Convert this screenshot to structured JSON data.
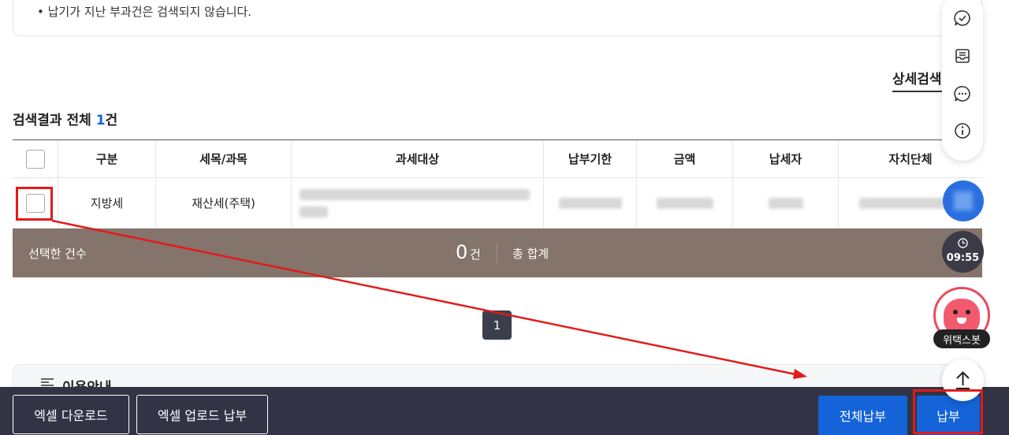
{
  "notice": {
    "text": "• 납기가 지난 부과건은 검색되지 않습니다."
  },
  "detail_search": {
    "label": "상세검색"
  },
  "results": {
    "title_prefix": "검색결과 전체 ",
    "count": "1",
    "count_suffix": "건"
  },
  "table": {
    "columns": [
      "구분",
      "세목/과목",
      "과세대상",
      "납부기한",
      "금액",
      "납세자",
      "자치단체"
    ],
    "rows": [
      {
        "category": "지방세",
        "tax_item": "재산세(주택)"
      }
    ]
  },
  "summary": {
    "selected_label": "선택한 건수",
    "selected_count": "0",
    "selected_unit": "건",
    "total_label": "총 합계"
  },
  "pagination": {
    "current": "1"
  },
  "usage": {
    "title": "이용안내"
  },
  "bottom": {
    "excel_download": "엑셀 다운로드",
    "excel_upload_pay": "엑셀 업로드 납부",
    "pay_all": "전체납부",
    "pay": "납부"
  },
  "widgets": {
    "timer": "09:55",
    "bot_label": "위택스봇"
  },
  "colors": {
    "accent_blue": "#1463d9",
    "summary_bg": "#84746b",
    "bottom_bar": "#323445",
    "annotation_red": "#e21b1b"
  }
}
